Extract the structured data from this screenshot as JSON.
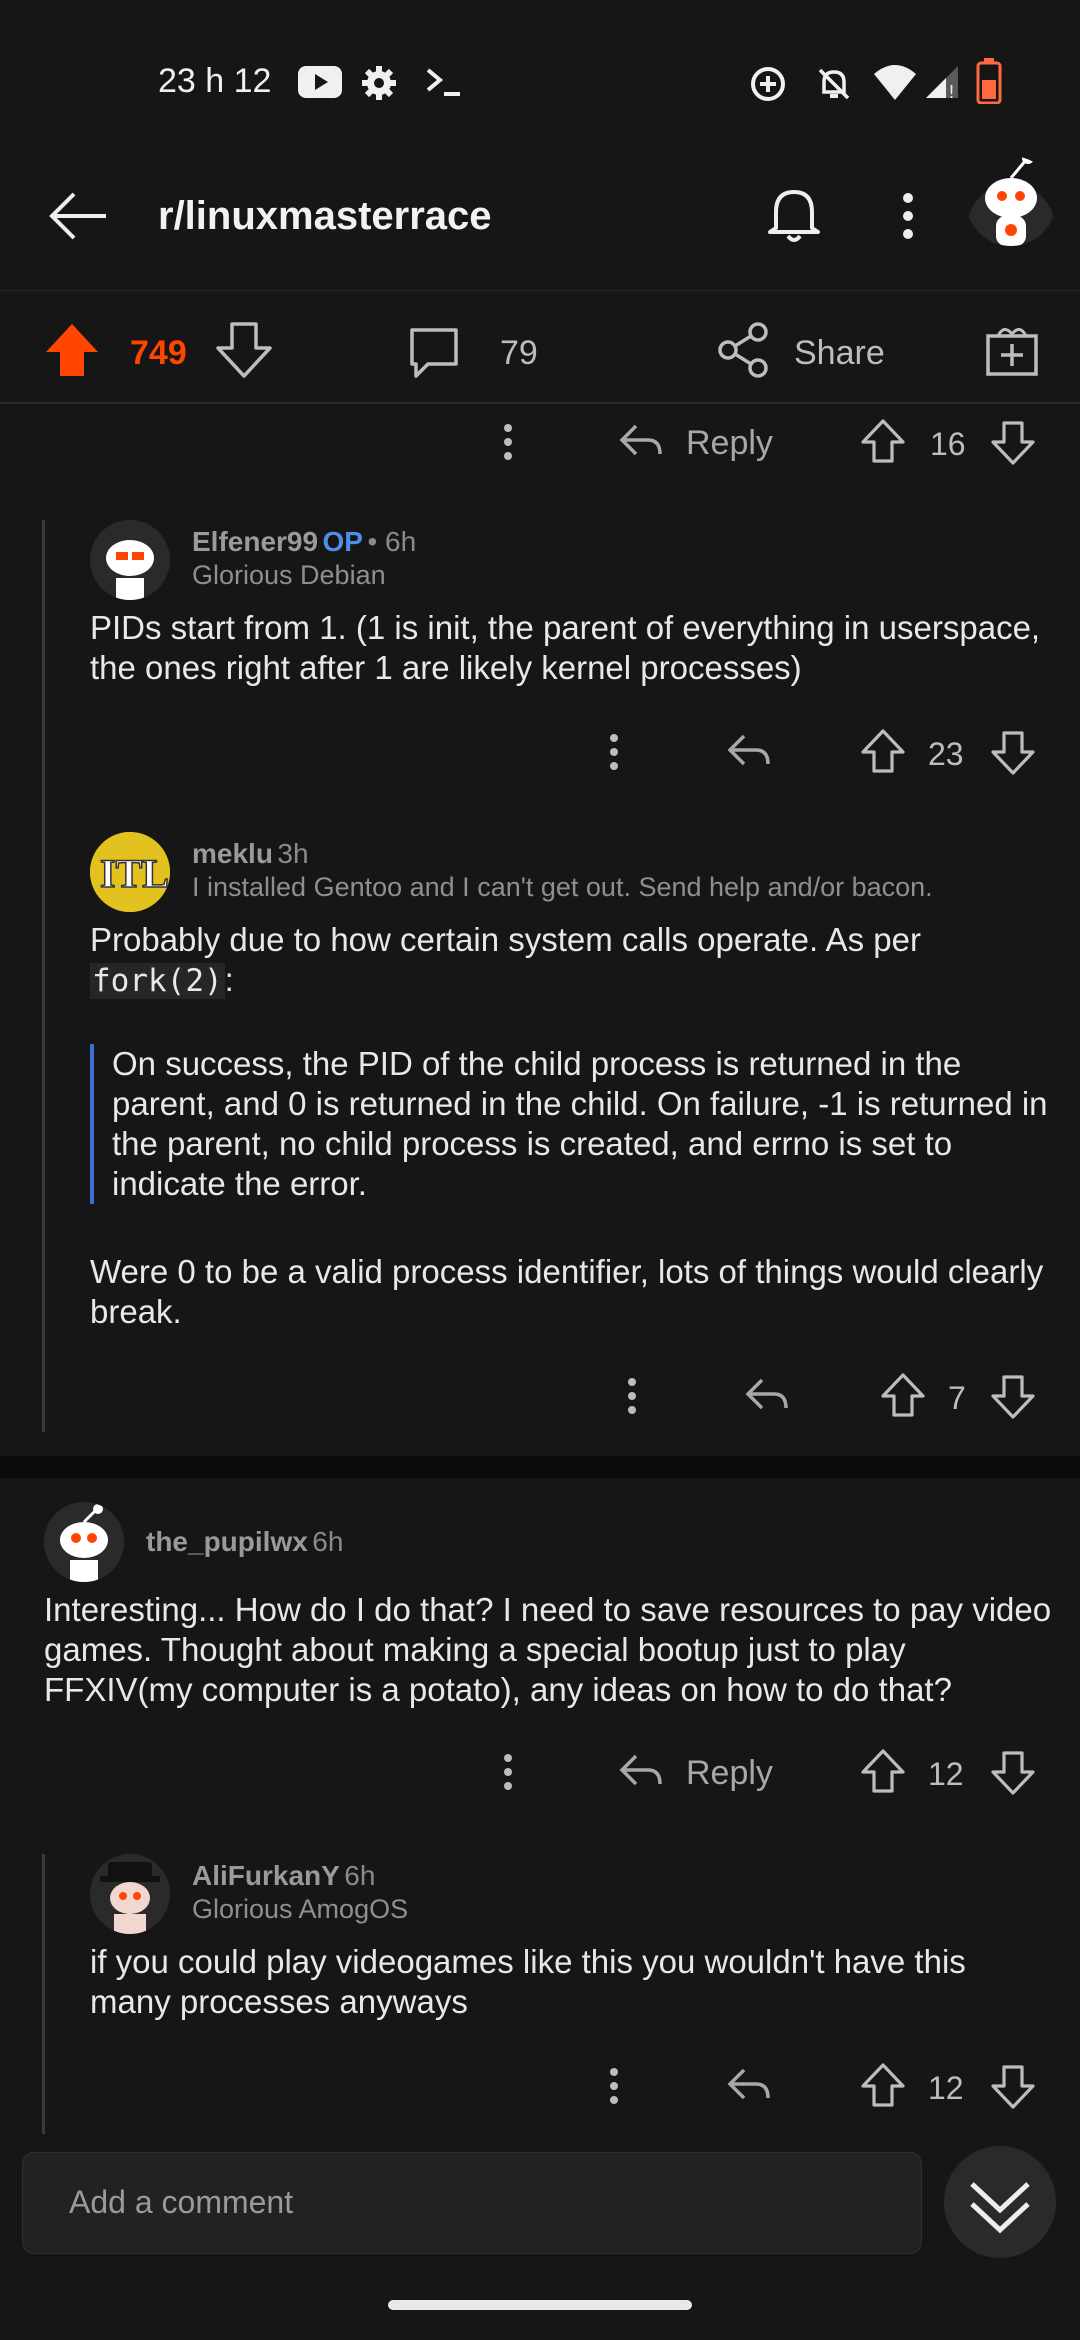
{
  "status_bar": {
    "time": "23 h 12"
  },
  "header": {
    "subreddit": "r/linuxmasterrace"
  },
  "post_actions": {
    "score": "749",
    "comments": "79",
    "share_label": "Share"
  },
  "comments": [
    {
      "id": "c0",
      "reply_label": "Reply",
      "score": "16"
    },
    {
      "id": "c1",
      "author": "Elfener99",
      "op_badge": "OP",
      "age": "• 6h",
      "flair": "Glorious Debian",
      "body": "PIDs start from 1. (1 is init, the parent of everything in userspace, the ones right after 1 are likely kernel processes)",
      "score": "23"
    },
    {
      "id": "c2",
      "author": "meklu",
      "age": "3h",
      "flair": "I installed Gentoo and I can't get out. Send help and/or bacon.",
      "body_intro": "Probably due to how certain system calls operate. As per",
      "code": "fork(2)",
      "after_code": ":",
      "quote": "On success, the PID of the child process is returned in the parent, and 0 is returned in the child.  On failure, -1 is returned in the parent, no child process is created, and errno is set to indicate the error.",
      "body_end": "Were 0 to be a valid process identifier, lots of things would clearly break.",
      "score": "7"
    },
    {
      "id": "c3",
      "author": "the_pupilwx",
      "age": "6h",
      "body": "Interesting... How do I do that? I need to save resources to pay video games. Thought about making a special bootup just to play FFXIV(my computer is a potato), any ideas on how to do that?",
      "reply_label": "Reply",
      "score": "12"
    },
    {
      "id": "c4",
      "author": "AliFurkanY",
      "age": "6h",
      "flair": "Glorious AmogOS",
      "body": "if you could play videogames like this you wouldn't have this many processes anyways",
      "score": "12"
    }
  ],
  "composer": {
    "placeholder": "Add a comment"
  },
  "colors": {
    "accent": "#ff4500",
    "op": "#4f8de8",
    "quote_bar": "#3d6ed6"
  }
}
